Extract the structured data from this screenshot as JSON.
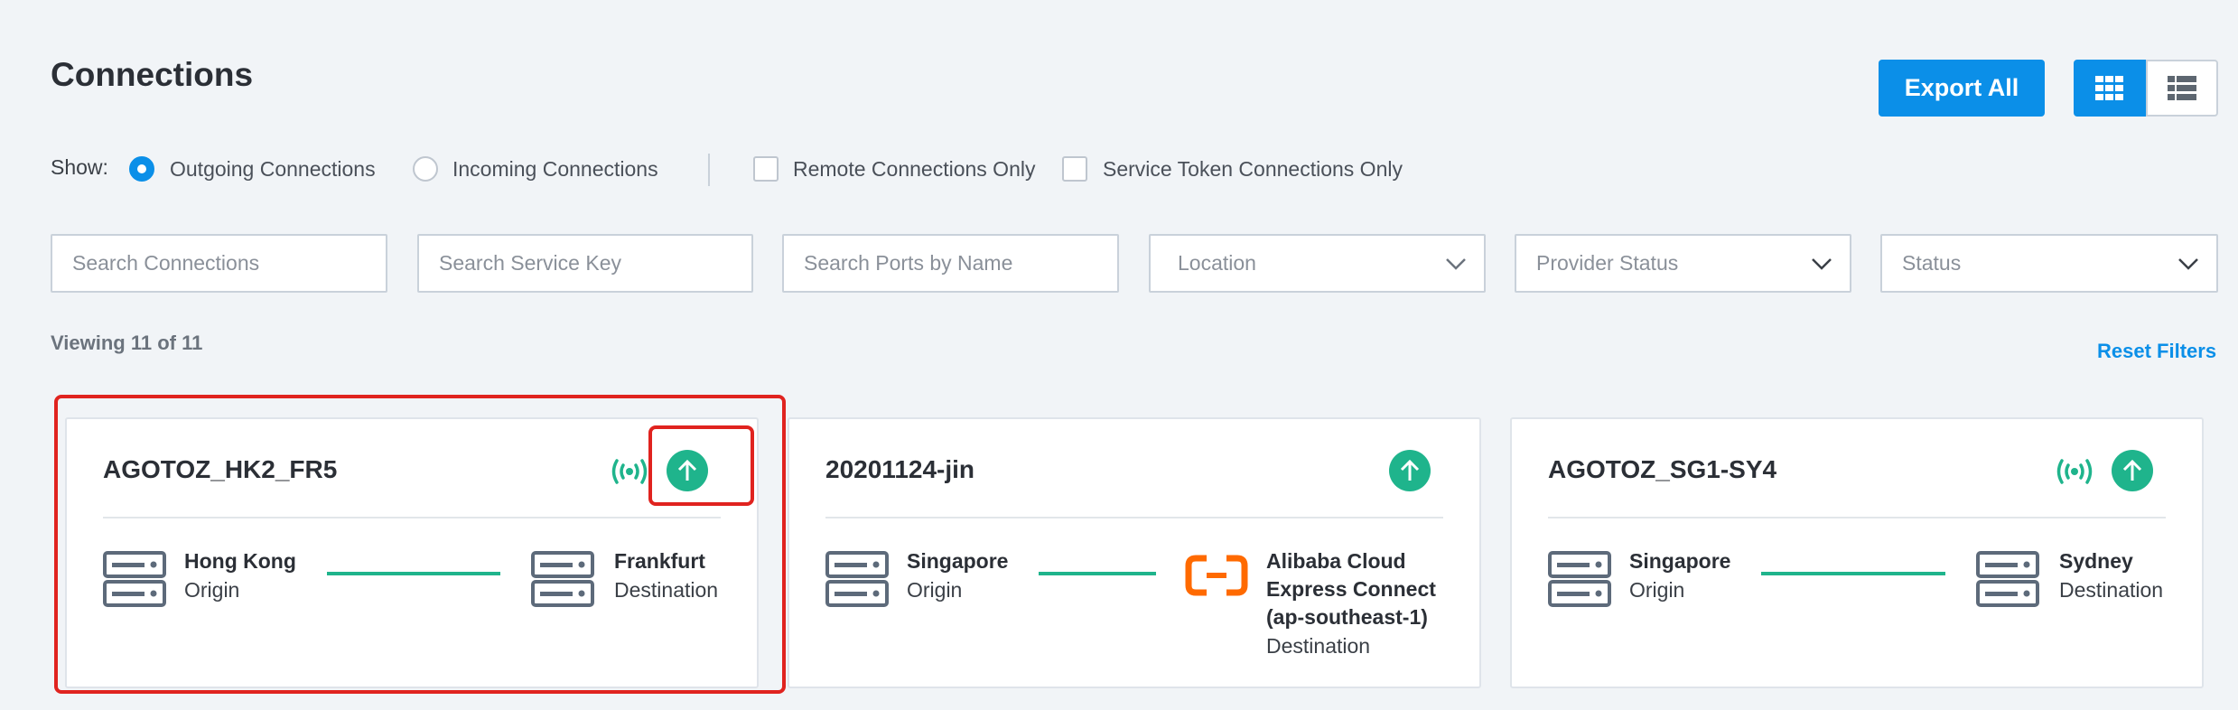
{
  "header": {
    "title": "Connections",
    "export_label": "Export All",
    "view_grid_icon": "grid-view-icon",
    "view_list_icon": "list-view-icon"
  },
  "filters_row": {
    "show_label": "Show:",
    "outgoing_label": "Outgoing Connections",
    "outgoing_selected": true,
    "incoming_label": "Incoming Connections",
    "remote_only_label": "Remote Connections Only",
    "service_token_only_label": "Service Token Connections Only"
  },
  "search": {
    "connections_placeholder": "Search Connections",
    "service_key_placeholder": "Search Service Key",
    "ports_placeholder": "Search Ports by Name",
    "location_label": "Location",
    "provider_status_label": "Provider Status",
    "status_label": "Status"
  },
  "summary": {
    "viewing": "Viewing 11 of 11",
    "reset_label": "Reset Filters"
  },
  "colors": {
    "accent": "#0b8fe8",
    "status_up": "#1fb48c",
    "highlight": "#e0231f",
    "alibaba": "#ff6a00"
  },
  "cards": [
    {
      "name": "AGOTOZ_HK2_FR5",
      "origin": "Hong Kong",
      "origin_role": "Origin",
      "destination": "Frankfurt",
      "destination_role": "Destination",
      "icons": [
        "wireless-signal-icon",
        "status-up-arrow-icon"
      ]
    },
    {
      "name": "20201124-jin",
      "origin": "Singapore",
      "origin_role": "Origin",
      "destination_line1": "Alibaba Cloud",
      "destination_line2": "Express Connect",
      "destination_line3": "(ap-southeast-1)",
      "destination_role": "Destination",
      "icons": [
        "status-up-arrow-icon",
        "alibaba-cloud-logo-icon"
      ]
    },
    {
      "name": "AGOTOZ_SG1-SY4",
      "origin": "Singapore",
      "origin_role": "Origin",
      "destination": "Sydney",
      "destination_role": "Destination",
      "icons": [
        "wireless-signal-icon",
        "status-up-arrow-icon"
      ]
    }
  ]
}
